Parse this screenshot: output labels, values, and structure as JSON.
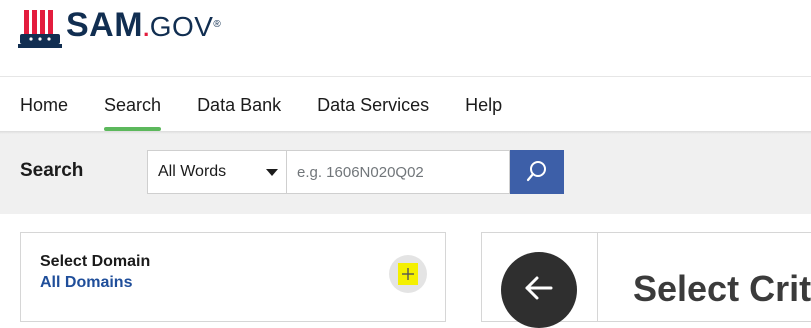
{
  "brand": {
    "logo_text": "SAM",
    "logo_dot": ".",
    "logo_suffix": "GOV",
    "registered": "®",
    "icon": "uncle-sam-hat-icon"
  },
  "nav": {
    "items": [
      {
        "label": "Home",
        "active": false
      },
      {
        "label": "Search",
        "active": true
      },
      {
        "label": "Data Bank",
        "active": false
      },
      {
        "label": "Data Services",
        "active": false
      },
      {
        "label": "Help",
        "active": false
      }
    ],
    "active_color": "#5cb85c"
  },
  "search": {
    "label": "Search",
    "mode_selected": "All Words",
    "placeholder": "e.g. 1606N020Q02",
    "value": "",
    "button_icon": "search-icon",
    "button_color": "#3d5fa8"
  },
  "domain": {
    "label": "Select Domain",
    "value": "All Domains",
    "add_icon": "plus-icon",
    "highlight_color": "#f4f000"
  },
  "criteria": {
    "title": "Select Crite",
    "back_icon": "arrow-left-icon"
  }
}
